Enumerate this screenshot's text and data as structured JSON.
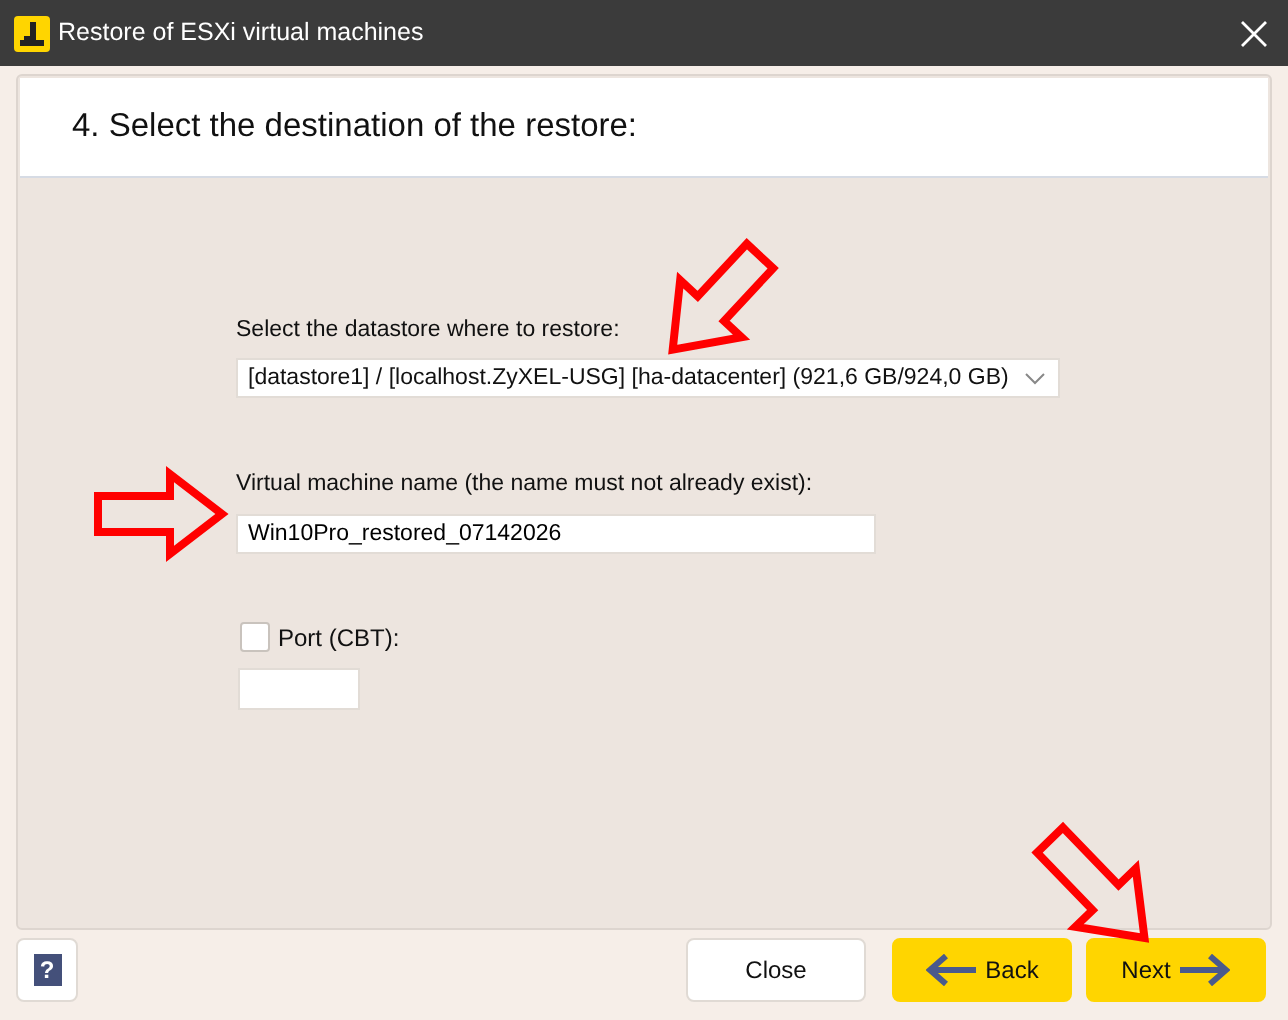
{
  "window": {
    "title": "Restore of ESXi virtual machines"
  },
  "step": {
    "title": "4. Select the destination of the restore:"
  },
  "datastore": {
    "label": "Select the datastore where to restore:",
    "value": "[datastore1] / [localhost.ZyXEL-USG] [ha-datacenter] (921,6 GB/924,0 GB)"
  },
  "vm_name": {
    "label": "Virtual machine name (the name must not already exist):",
    "value": "Win10Pro_restored_07142026"
  },
  "port": {
    "label": "Port (CBT):",
    "checked": false
  },
  "help": {
    "label": "?"
  },
  "buttons": [
    {
      "kind": "close",
      "label": "Close"
    },
    {
      "kind": "back",
      "label": "Back"
    },
    {
      "kind": "next",
      "label": "Next"
    }
  ]
}
